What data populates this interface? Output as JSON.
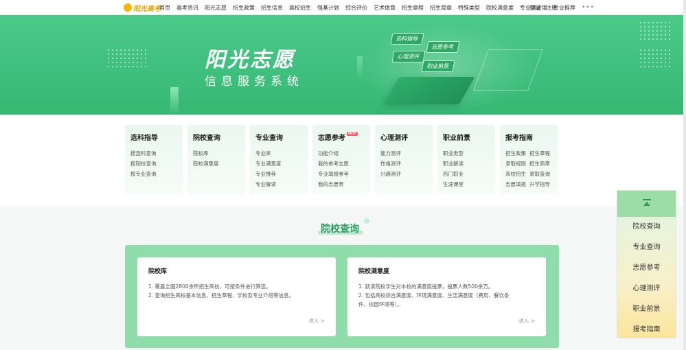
{
  "nav": {
    "logo_text": "阳光高考",
    "items": [
      "首页",
      "高考资讯",
      "阳光志愿",
      "招生政策",
      "招生信息",
      "高校招生",
      "强基计划",
      "综合评价",
      "艺术体育",
      "招生章程",
      "招生简章",
      "特殊类型",
      "院校满意度",
      "专业满意度",
      "专业推荐"
    ],
    "more": "•••",
    "login": "登录",
    "register": "注册"
  },
  "banner": {
    "title": "阳光志愿",
    "subtitle": "信息服务系统",
    "tags": [
      "选科指导",
      "志愿参考",
      "心理测评",
      "职业前景"
    ]
  },
  "categories": [
    {
      "title": "选科指导",
      "hot": "",
      "links": [
        "按选科查询",
        "按院校查询",
        "按专业查询"
      ]
    },
    {
      "title": "院校查询",
      "hot": "",
      "links": [
        "院校库",
        "院校满意度"
      ]
    },
    {
      "title": "专业查询",
      "hot": "",
      "links": [
        "专业库",
        "专业满意度",
        "专业推荐",
        "专业解读"
      ]
    },
    {
      "title": "志愿参考",
      "hot": "HOT",
      "links": [
        "功能介绍",
        "我的参考志愿",
        "专业填报参考",
        "我的志愿表"
      ]
    },
    {
      "title": "心理测评",
      "hot": "",
      "links": [
        "能力测评",
        "性格测评",
        "兴趣测评"
      ]
    },
    {
      "title": "职业前景",
      "hot": "",
      "links": [
        "职业类型",
        "职业解读",
        "热门职业",
        "生涯课堂"
      ]
    },
    {
      "title": "报考指南",
      "hot": "",
      "links": [
        "招生政策",
        "招生章程",
        "录取规则",
        "招生简章",
        "高校招生",
        "录取查询",
        "志愿填报",
        "升学指导"
      ]
    }
  ],
  "section": {
    "title": "院校查询",
    "cards": [
      {
        "title": "院校库",
        "lines": [
          "1. 覆盖全国2800余所招生高校，可按条件进行筛选。",
          "2. 查询招生高校基本信息、招生章程、学校及专业介绍等信息。"
        ],
        "more": "进入 >"
      },
      {
        "title": "院校满意度",
        "lines": [
          "1. 就读院校学生对本校的满意度投票，投票人数500余万。",
          "2. 包括高校综合满意度、环境满意度、生活满意度（费用、餐饮条",
          "件、校园环境等）。"
        ],
        "more": "进入 >"
      }
    ]
  },
  "side_panel": {
    "items": [
      "院校查询",
      "专业查询",
      "志愿参考",
      "心理测评",
      "职业前景",
      "报考指南"
    ]
  }
}
